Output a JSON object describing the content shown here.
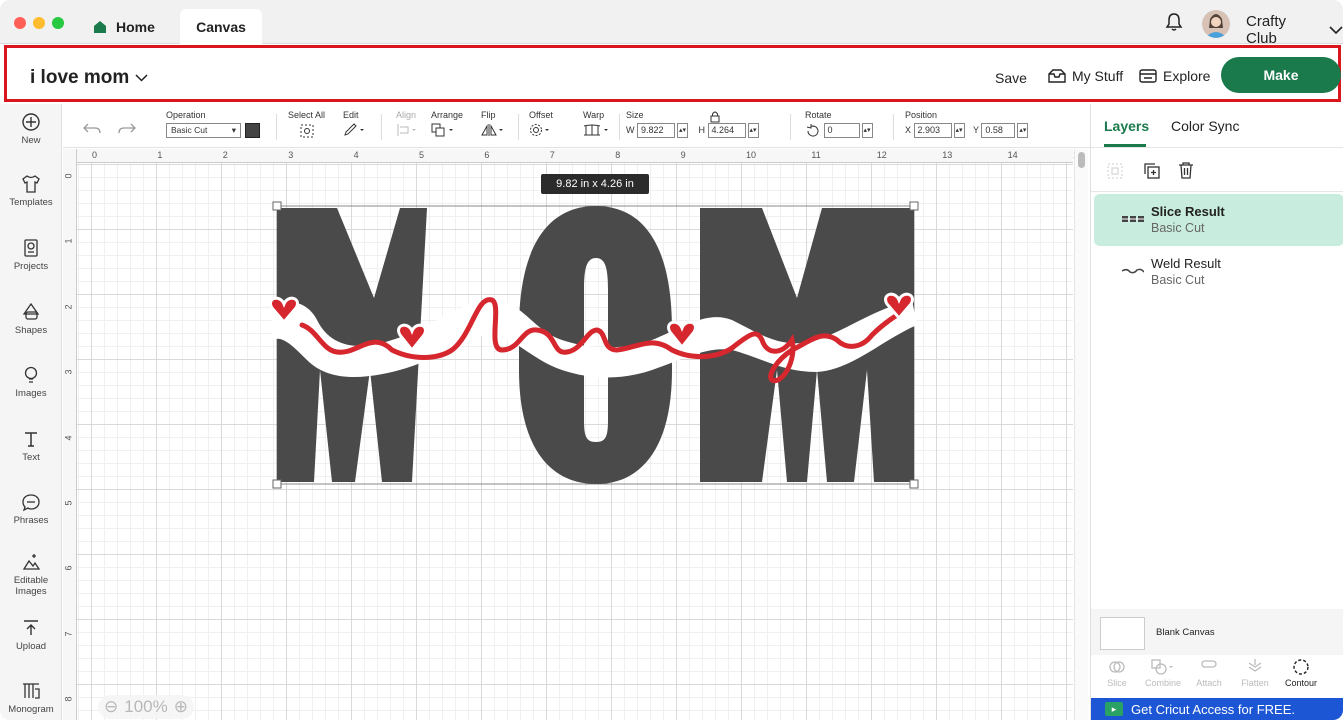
{
  "titlebar": {
    "tabs": [
      {
        "label": "Home",
        "icon": "home-icon"
      },
      {
        "label": "Canvas"
      }
    ],
    "account_name": "Crafty Club"
  },
  "project": {
    "title": "i love mom",
    "save_label": "Save",
    "mystuff_label": "My Stuff",
    "explore_label": "Explore",
    "make_label": "Make",
    "make_color": "#1a7a4c"
  },
  "sidebar": {
    "items": [
      {
        "label": "New",
        "icon": "plus-circle-icon"
      },
      {
        "label": "Templates",
        "icon": "shirt-icon"
      },
      {
        "label": "Projects",
        "icon": "projects-icon"
      },
      {
        "label": "Shapes",
        "icon": "shapes-icon"
      },
      {
        "label": "Images",
        "icon": "lightbulb-icon"
      },
      {
        "label": "Text",
        "icon": "text-icon"
      },
      {
        "label": "Phrases",
        "icon": "speech-bubble-icon"
      },
      {
        "label": "Editable Images",
        "icon": "editable-images-icon"
      },
      {
        "label": "Upload",
        "icon": "upload-icon"
      },
      {
        "label": "Monogram",
        "icon": "monogram-icon"
      }
    ]
  },
  "toolbar": {
    "operation_label": "Operation",
    "operation_value": "Basic Cut",
    "select_all_label": "Select All",
    "edit_label": "Edit",
    "align_label": "Align",
    "arrange_label": "Arrange",
    "flip_label": "Flip",
    "offset_label": "Offset",
    "warp_label": "Warp",
    "size_label": "Size",
    "w_label": "W",
    "w_value": "9.822",
    "h_label": "H",
    "h_value": "4.264",
    "rotate_label": "Rotate",
    "rotate_value": "0",
    "position_label": "Position",
    "x_label": "X",
    "x_value": "2.903",
    "y_label": "Y",
    "y_value": "0.58"
  },
  "canvas": {
    "ruler_top": [
      "0",
      "1",
      "2",
      "3",
      "4",
      "5",
      "6",
      "7",
      "8",
      "9",
      "10",
      "11",
      "12",
      "13",
      "14",
      "1"
    ],
    "ruler_left": [
      "0",
      "1",
      "2",
      "3",
      "4",
      "5",
      "6",
      "7",
      "8"
    ],
    "size_tooltip": "9.82  in x 4.26  in",
    "design_word": "MOM",
    "design_script": "i love you",
    "zoom_level": "100%",
    "colors": {
      "letters": "#4a4a4a",
      "script": "#d6262e",
      "offset": "#ffffff"
    }
  },
  "layers_panel": {
    "tabs": [
      "Layers",
      "Color Sync"
    ],
    "layers": [
      {
        "name": "Slice Result",
        "sub": "Basic Cut",
        "selected": true
      },
      {
        "name": "Weld Result",
        "sub": "Basic Cut",
        "selected": false
      }
    ],
    "blank_canvas_label": "Blank Canvas",
    "bottom_tools": [
      {
        "label": "Slice",
        "enabled": false
      },
      {
        "label": "Combine",
        "enabled": false
      },
      {
        "label": "Attach",
        "enabled": false
      },
      {
        "label": "Flatten",
        "enabled": false
      },
      {
        "label": "Contour",
        "enabled": true
      }
    ],
    "promo_text": "Get Cricut Access for FREE.",
    "promo_color": "#1d56d4"
  }
}
